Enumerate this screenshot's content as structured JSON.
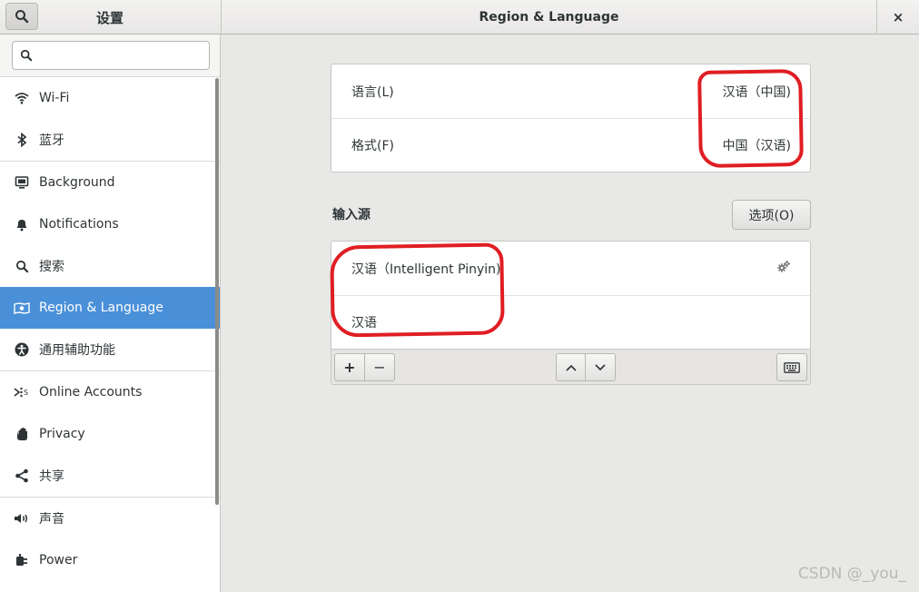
{
  "header": {
    "app_title": "设置",
    "panel_title": "Region & Language",
    "close_label": "×"
  },
  "sidebar": {
    "search_placeholder": "",
    "items": [
      {
        "label": "Wi-Fi",
        "icon": "wifi-icon"
      },
      {
        "label": "蓝牙",
        "icon": "bluetooth-icon"
      },
      {
        "label": "Background",
        "icon": "background-icon"
      },
      {
        "label": "Notifications",
        "icon": "bell-icon"
      },
      {
        "label": "搜索",
        "icon": "search-icon"
      },
      {
        "label": "Region & Language",
        "icon": "region-language-icon",
        "active": true
      },
      {
        "label": "通用辅助功能",
        "icon": "accessibility-icon"
      },
      {
        "label": "Online Accounts",
        "icon": "online-accounts-icon"
      },
      {
        "label": "Privacy",
        "icon": "hand-icon"
      },
      {
        "label": "共享",
        "icon": "share-icon"
      },
      {
        "label": "声音",
        "icon": "speaker-icon"
      },
      {
        "label": "Power",
        "icon": "power-plug-icon"
      }
    ]
  },
  "region": {
    "language_label": "语言(L)",
    "language_value": "汉语（中国)",
    "formats_label": "格式(F)",
    "formats_value": "中国（汉语)"
  },
  "input_sources": {
    "section_label": "输入源",
    "options_button": "选项(O)",
    "sources": [
      {
        "label": "汉语（Intelligent Pinyin)",
        "has_settings": true
      },
      {
        "label": "汉语",
        "has_settings": false
      }
    ],
    "add_label": "+",
    "remove_label": "−"
  },
  "watermark": "CSDN @_you_",
  "colors": {
    "accent": "#4a90d9",
    "annotation": "#e01e23"
  }
}
